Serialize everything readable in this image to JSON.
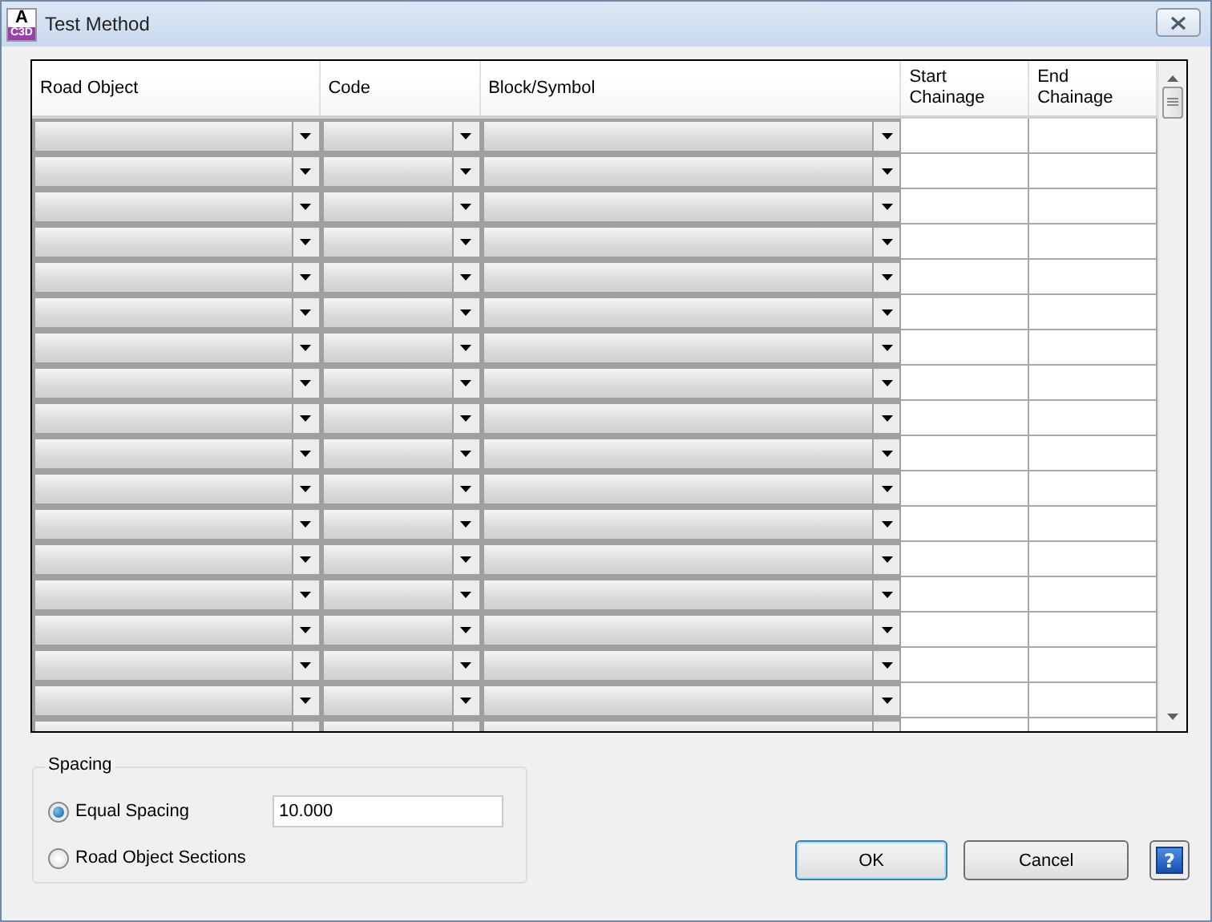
{
  "window": {
    "title": "Test Method",
    "app_icon": {
      "letter": "A",
      "caption": "C3D"
    }
  },
  "table": {
    "columns": [
      {
        "label": "Road Object",
        "kind": "combo"
      },
      {
        "label": "Code",
        "kind": "combo"
      },
      {
        "label": "Block/Symbol",
        "kind": "combo"
      },
      {
        "label": "Start Chainage",
        "kind": "text"
      },
      {
        "label": "End Chainage",
        "kind": "text"
      }
    ],
    "rows": [
      {
        "kind": "entry"
      },
      {
        "kind": "entry"
      },
      {
        "kind": "entry"
      },
      {
        "kind": "entry"
      },
      {
        "kind": "entry"
      },
      {
        "kind": "entry"
      },
      {
        "kind": "entry"
      },
      {
        "kind": "entry"
      },
      {
        "kind": "entry"
      },
      {
        "kind": "entry"
      },
      {
        "kind": "entry"
      },
      {
        "kind": "entry"
      },
      {
        "kind": "entry"
      },
      {
        "kind": "entry"
      },
      {
        "kind": "entry"
      },
      {
        "kind": "entry"
      },
      {
        "kind": "entry"
      },
      {
        "kind": "entry"
      }
    ]
  },
  "spacing": {
    "title": "Spacing",
    "options": [
      {
        "label": "Equal Spacing",
        "selected": true,
        "value": "10.000"
      },
      {
        "label": "Road Object Sections",
        "selected": false
      }
    ]
  },
  "buttons": [
    {
      "label": "OK",
      "default": true
    },
    {
      "label": "Cancel",
      "default": false
    }
  ],
  "help_button": {
    "label": "?"
  }
}
